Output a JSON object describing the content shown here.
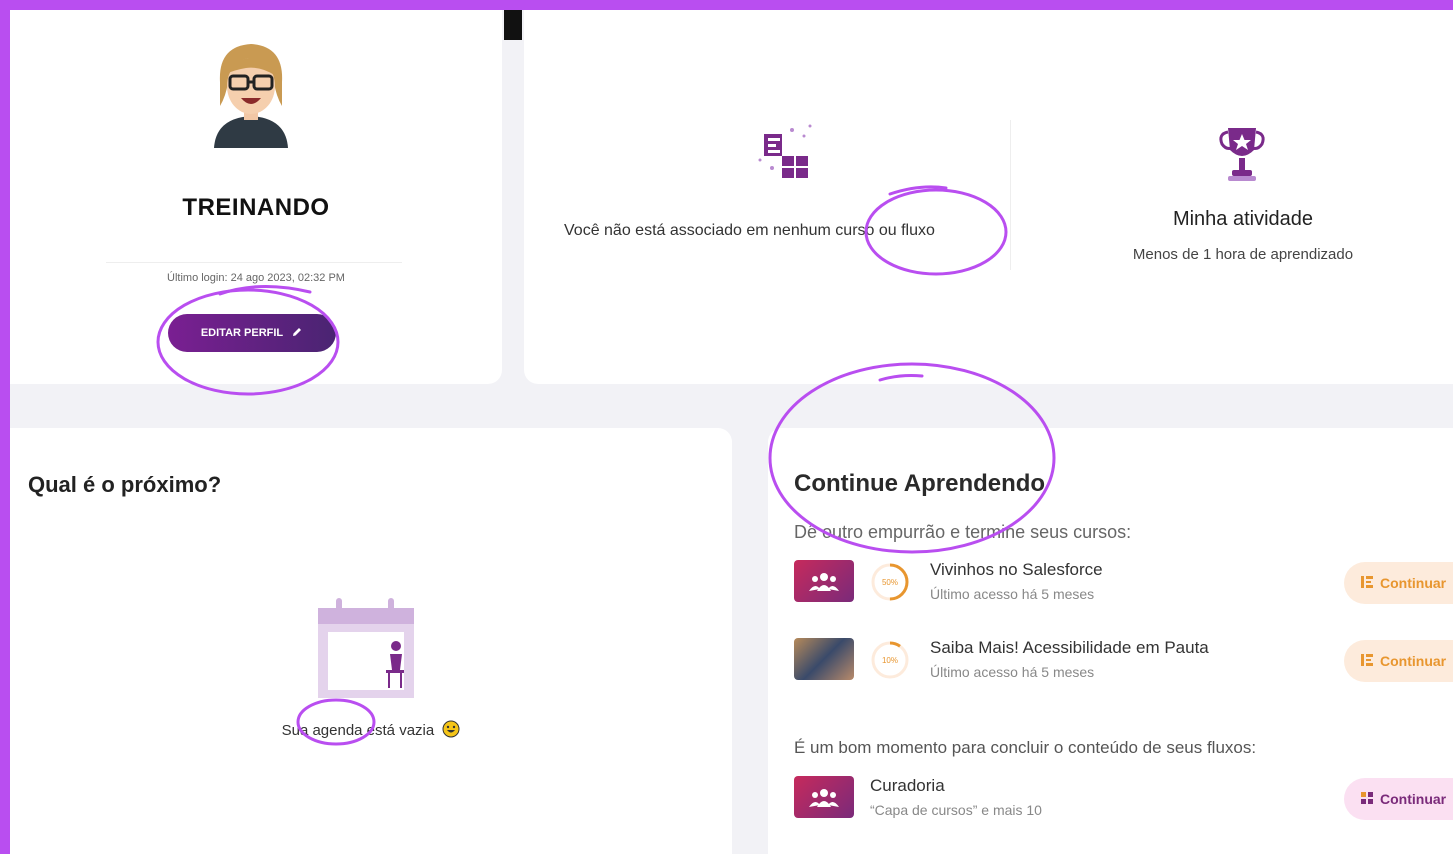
{
  "profile": {
    "name": "TREINANDO",
    "last_login": "Último login: 24 ago 2023, 02:32 PM",
    "edit_button": "EDITAR PERFIL"
  },
  "stats": {
    "no_assoc_text": "Você não está associado em nenhum curso ou fluxo",
    "activity_title": "Minha atividade",
    "activity_sub": "Menos de 1 hora de aprendizado"
  },
  "next": {
    "title": "Qual é o próximo?",
    "agenda_empty": "Sua agenda está vazia"
  },
  "continue": {
    "title": "Continue Aprendendo",
    "subtitle": "Dê outro empurrão e termine seus cursos:",
    "courses": [
      {
        "title": "Vivinhos no Salesforce",
        "sub": "Último acesso há 5 meses",
        "progress_label": "50%",
        "progress": 0.5,
        "button": "Continuar"
      },
      {
        "title": "Saiba Mais! Acessibilidade em Pauta",
        "sub": "Último acesso há 5 meses",
        "progress_label": "10%",
        "progress": 0.1,
        "button": "Continuar"
      }
    ],
    "fluxos_text": "É um bom momento para concluir o conteúdo de seus fluxos:",
    "fluxos": [
      {
        "title": "Curadoria",
        "sub": "“Capa de cursos” e mais 10",
        "button": "Continuar"
      }
    ]
  },
  "colors": {
    "frame": "#b94ef0",
    "accent_purple": "#7a1f92",
    "orange": "#e8962f",
    "annotation": "#b94ef0"
  }
}
